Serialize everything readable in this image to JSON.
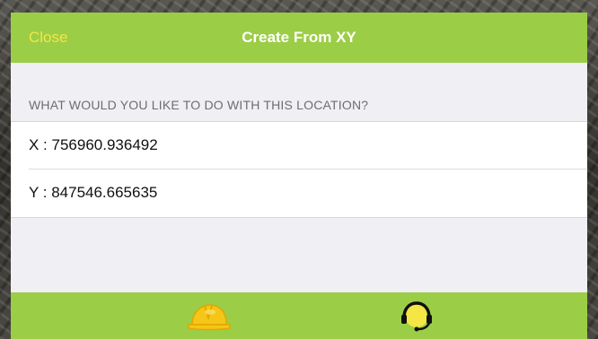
{
  "navbar": {
    "close_label": "Close",
    "title": "Create From XY"
  },
  "section": {
    "header": "WHAT WOULD YOU LIKE TO DO WITH THIS LOCATION?"
  },
  "fields": {
    "x": "X : 756960.936492",
    "y": "Y : 847546.665635"
  },
  "tabbar": {
    "items": [
      {
        "icon": "hard-hat-icon",
        "color": "#f5c518"
      },
      {
        "icon": "headset-icon",
        "color": "#111111",
        "accent": "#f3e645"
      }
    ]
  },
  "colors": {
    "accent_green": "#9ccd47",
    "close_yellow": "#f3e645",
    "background": "#efeff4"
  }
}
